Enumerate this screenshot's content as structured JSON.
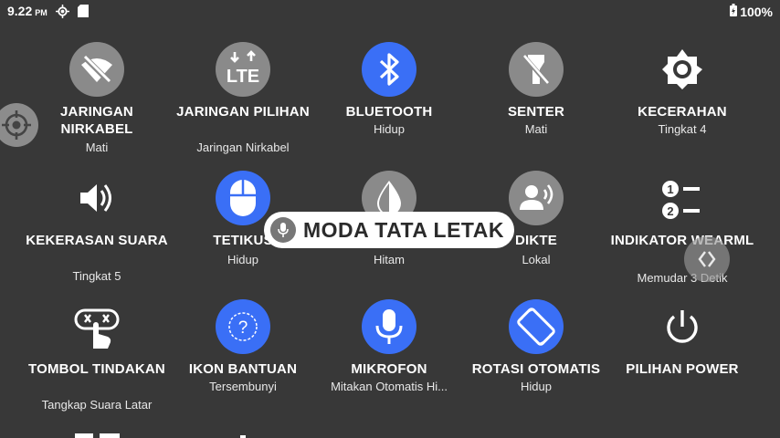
{
  "status": {
    "time": "9.22",
    "ampm": "PM",
    "battery": "100%",
    "icons": [
      "location-target-icon",
      "sd-card-icon",
      "battery-icon"
    ]
  },
  "tiles": [
    {
      "name": "wifi",
      "icon": "wifi-off-icon",
      "label": "JARINGAN NIRKABEL",
      "sub": "Mati",
      "state": "off"
    },
    {
      "name": "mobile-data",
      "icon": "lte-icon",
      "label": "JARINGAN PILIHAN",
      "sub": "Jaringan Nirkabel",
      "state": "off"
    },
    {
      "name": "bluetooth",
      "icon": "bluetooth-icon",
      "label": "BLUETOOTH",
      "sub": "Hidup",
      "state": "on"
    },
    {
      "name": "flashlight",
      "icon": "flashlight-off-icon",
      "label": "SENTER",
      "sub": "Mati",
      "state": "off"
    },
    {
      "name": "brightness",
      "icon": "brightness-icon",
      "label": "KECERAHAN",
      "sub": "Tingkat 4",
      "state": "plain"
    },
    {
      "name": "volume",
      "icon": "volume-icon",
      "label": "KEKERASAN SUARA",
      "sub": "Tingkat 5",
      "state": "plain"
    },
    {
      "name": "mouse",
      "icon": "mouse-icon",
      "label": "TETIKUS",
      "sub": "Hidup",
      "state": "on"
    },
    {
      "name": "theme",
      "icon": "theme-drop-icon",
      "label": "",
      "sub": "Hitam",
      "state": "off"
    },
    {
      "name": "dictation",
      "icon": "dictation-icon",
      "label": "DIKTE",
      "sub": "Lokal",
      "state": "off"
    },
    {
      "name": "wearml-indicator",
      "icon": "numbered-list-icon",
      "label": "INDIKATOR WEARML",
      "sub": "Memudar 3 Detik",
      "state": "plain"
    },
    {
      "name": "action-button",
      "icon": "action-button-icon",
      "label": "TOMBOL TINDAKAN",
      "sub": "Tangkap Suara Latar",
      "state": "plain"
    },
    {
      "name": "help-icons",
      "icon": "help-icon",
      "label": "IKON BANTUAN",
      "sub": "Tersembunyi",
      "state": "on"
    },
    {
      "name": "microphone",
      "icon": "microphone-icon",
      "label": "MIKROFON",
      "sub": "Mitakan Otomatis Hi...",
      "state": "on"
    },
    {
      "name": "auto-rotate",
      "icon": "rotate-icon",
      "label": "ROTASI OTOMATIS",
      "sub": "Hidup",
      "state": "on"
    },
    {
      "name": "power-options",
      "icon": "power-icon",
      "label": "PILIHAN POWER",
      "sub": "",
      "state": "plain"
    }
  ],
  "toast": {
    "text": "MODA TATA LETAK",
    "icon": "mic-icon"
  },
  "colors": {
    "background": "#383838",
    "on": "#3a6ff6",
    "off": "#8a8a8a"
  }
}
